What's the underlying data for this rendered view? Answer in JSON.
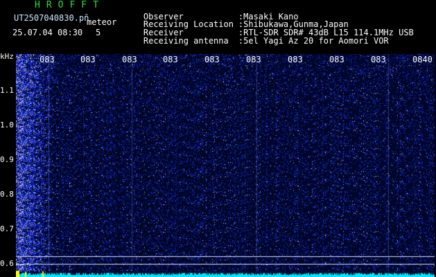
{
  "header": {
    "app_title": "HROFFT",
    "filename": "UT2507040830.pn̄",
    "detector": "meteor",
    "datetime": "25.07.04 08:30",
    "count": "5"
  },
  "info": [
    {
      "label": "Observer",
      "value": ":Masaki Kano"
    },
    {
      "label": "Receiving Location",
      "value": ":Shibukawa,Gunma,Japan"
    },
    {
      "label": "Receiver",
      "value": ":RTL-SDR SDR# 43dB L15 114.1MHz USB"
    },
    {
      "label": "Receiving antenna",
      "value": ":5el Yagi Az 20 for Aomori VOR"
    }
  ],
  "axis": {
    "y_unit": "kHz",
    "y_ticks": [
      "1.1",
      "1.0",
      "0.9",
      "0.8",
      "0.7",
      "0.6"
    ],
    "x_ticks": [
      "083",
      "083",
      "083",
      "083",
      "083",
      "083",
      "083",
      "083",
      "083",
      "0840"
    ]
  },
  "colors": {
    "background": "#000000",
    "title_green": "#22e33a",
    "noise_blue": "#1f3fd6",
    "baseline_cyan": "#00e6ff",
    "marker_yellow": "#ffff00"
  }
}
